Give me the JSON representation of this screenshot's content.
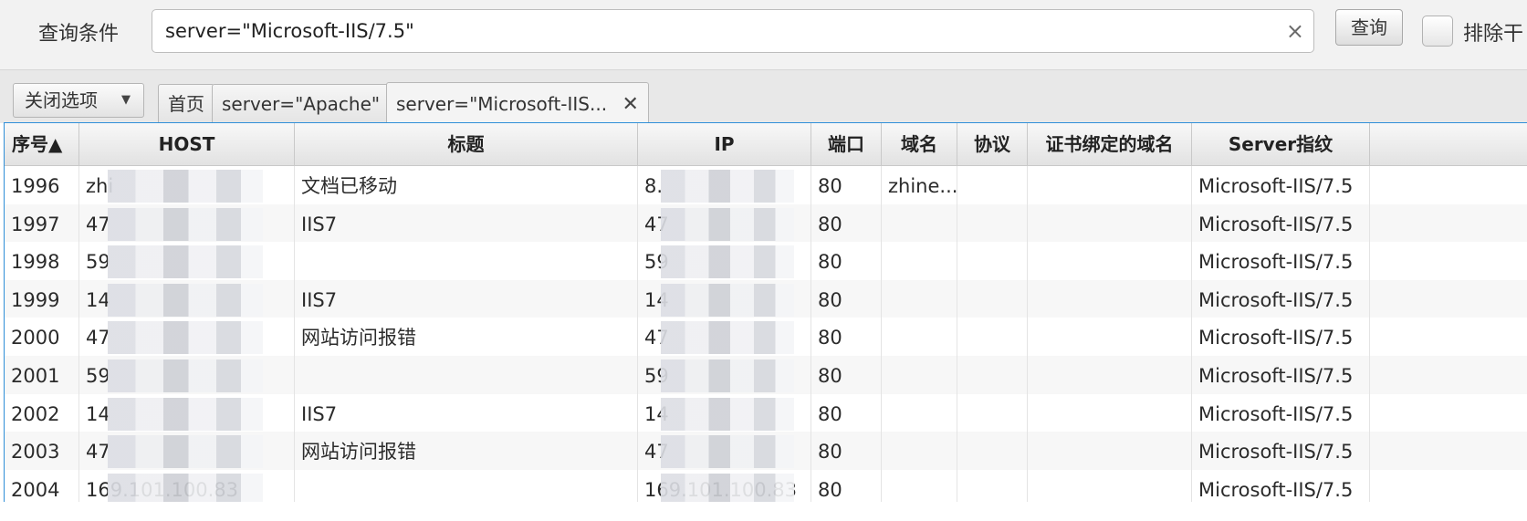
{
  "query": {
    "label": "查询条件",
    "value": "server=\"Microsoft-IIS/7.5\"",
    "clear_icon": "×",
    "button_label": "查询",
    "exclude_label": "排除干"
  },
  "tabs": {
    "close_options_label": "关闭选项",
    "dropdown_icon": "▼",
    "items": [
      {
        "label": "首页"
      },
      {
        "label": "server=\"Apache\""
      },
      {
        "label": "server=\"Microsoft-IIS..."
      }
    ],
    "close_icon": "✕"
  },
  "table": {
    "headers": [
      "序号▲",
      "HOST",
      "标题",
      "IP",
      "端口",
      "域名",
      "协议",
      "证书绑定的域名",
      "Server指纹"
    ],
    "rows": [
      {
        "seq": "1996",
        "host": "zhi",
        "title": "文档已移动",
        "ip": "8.",
        "port": "80",
        "domain": "zhine...",
        "protocol": "",
        "cert": "",
        "server": "Microsoft-IIS/7.5"
      },
      {
        "seq": "1997",
        "host": "47",
        "title": "IIS7",
        "ip": "47",
        "port": "80",
        "domain": "",
        "protocol": "",
        "cert": "",
        "server": "Microsoft-IIS/7.5"
      },
      {
        "seq": "1998",
        "host": "59",
        "title": "",
        "ip": "59",
        "port": "80",
        "domain": "",
        "protocol": "",
        "cert": "",
        "server": "Microsoft-IIS/7.5"
      },
      {
        "seq": "1999",
        "host": "14",
        "title": "IIS7",
        "ip": "14",
        "port": "80",
        "domain": "",
        "protocol": "",
        "cert": "",
        "server": "Microsoft-IIS/7.5"
      },
      {
        "seq": "2000",
        "host": "47",
        "title": "网站访问报错",
        "ip": "47",
        "port": "80",
        "domain": "",
        "protocol": "",
        "cert": "",
        "server": "Microsoft-IIS/7.5"
      },
      {
        "seq": "2001",
        "host": "59",
        "title": "",
        "ip": "59",
        "port": "80",
        "domain": "",
        "protocol": "",
        "cert": "",
        "server": "Microsoft-IIS/7.5"
      },
      {
        "seq": "2002",
        "host": "14",
        "title": "IIS7",
        "ip": "14",
        "port": "80",
        "domain": "",
        "protocol": "",
        "cert": "",
        "server": "Microsoft-IIS/7.5"
      },
      {
        "seq": "2003",
        "host": "47",
        "title": "网站访问报错",
        "ip": "47",
        "port": "80",
        "domain": "",
        "protocol": "",
        "cert": "",
        "server": "Microsoft-IIS/7.5"
      },
      {
        "seq": "2004",
        "host": "169.101.100.83",
        "title": "",
        "ip": "169.101.100.83",
        "port": "80",
        "domain": "",
        "protocol": "",
        "cert": "",
        "server": "Microsoft-IIS/7.5"
      }
    ]
  }
}
